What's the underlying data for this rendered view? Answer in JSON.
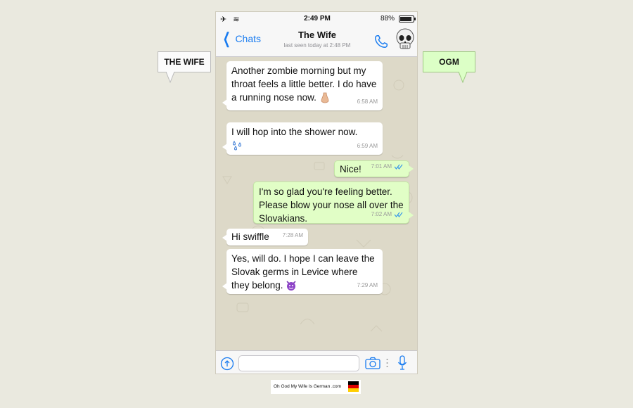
{
  "status_bar": {
    "time": "2:49 PM",
    "battery": "88%",
    "icons": [
      "airplane-icon",
      "wifi-icon",
      "battery-icon"
    ]
  },
  "nav": {
    "back_label": "Chats",
    "title": "The Wife",
    "subtitle": "last seen today at 2:48 PM",
    "icons": [
      "chevron-left-icon",
      "phone-icon",
      "skull-avatar"
    ]
  },
  "annotations": {
    "left_label": "THE WIFE",
    "right_label": "OGM"
  },
  "messages": [
    {
      "dir": "in",
      "text": "Another zombie morning but my throat feels a little better. I do have a running nose now.",
      "emoji": "nose-emoji",
      "time": "6:58 AM"
    },
    {
      "dir": "in",
      "text": "I will hop into the shower now.",
      "emoji": "droplets-emoji",
      "time": "6:59 AM"
    },
    {
      "dir": "out",
      "text": "Nice!",
      "time": "7:01 AM",
      "read": true
    },
    {
      "dir": "out",
      "text": "I'm so glad you're feeling better. Please blow your nose all over the Slovakians.",
      "time": "7:02 AM",
      "read": true
    },
    {
      "dir": "in",
      "text": "Hi swiffle",
      "time": "7:28 AM"
    },
    {
      "dir": "in",
      "text": "Yes, will do. I hope I can leave the Slovak germs in Levice where they belong.",
      "emoji": "devil-emoji",
      "time": "7:29 AM"
    }
  ],
  "input_bar": {
    "placeholder": "",
    "icons": [
      "plus-circle-icon",
      "camera-icon",
      "microphone-icon"
    ]
  },
  "footer": {
    "credit": "Oh God My Wife Is German .com"
  },
  "colors": {
    "accent": "#1a7cf0",
    "outgoing_bubble": "#e1fec6",
    "incoming_bubble": "#ffffff",
    "chat_bg": "#ddd9c8"
  }
}
